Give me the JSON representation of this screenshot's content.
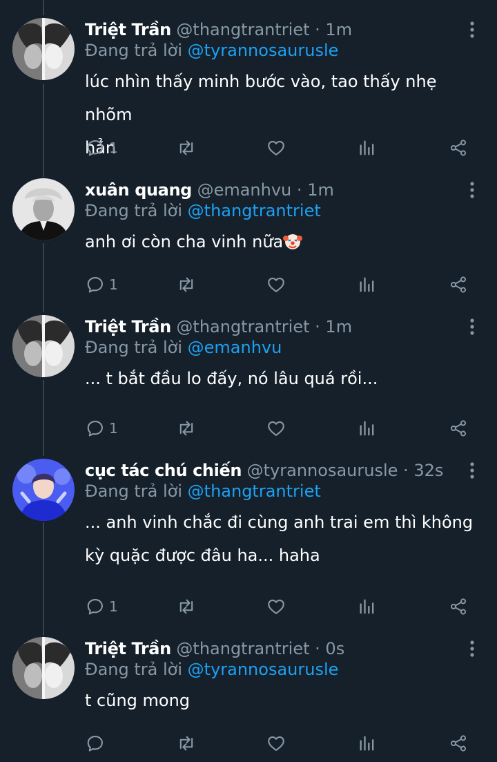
{
  "icons": {
    "more": "more-vertical-icon",
    "reply": "reply-bubble-icon",
    "retweet": "retweet-icon",
    "like": "heart-icon",
    "stats": "bar-chart-icon",
    "share": "share-icon",
    "emoji": "clown-face-emoji"
  },
  "colors": {
    "background": "#15202b",
    "link": "#1da1f2",
    "muted": "#8899a6",
    "thread_line": "#38444d"
  },
  "tweets": [
    {
      "name": "Triệt Trần",
      "handle": "@thangtrantriet",
      "time": "1m",
      "replying_prefix": "Đang trả lời",
      "reply_to": "@tyrannosaurusle",
      "text_lines": [
        "lúc nhìn thấy minh bước vào, tao thấy nhẹ nhõm",
        "hẳn"
      ],
      "reply_count": "1"
    },
    {
      "name": "xuân quang",
      "handle": "@emanhvu",
      "time": "1m",
      "replying_prefix": "Đang trả lời",
      "reply_to": "@thangtrantriet",
      "text_lines": [
        "anh ơi còn cha vinh nữa"
      ],
      "reply_count": "1"
    },
    {
      "name": "Triệt Trần",
      "handle": "@thangtrantriet",
      "time": "1m",
      "replying_prefix": "Đang trả lời",
      "reply_to": "@emanhvu",
      "text_lines": [
        "... t bắt đầu lo đấy, nó lâu quá rồi..."
      ],
      "reply_count": "1"
    },
    {
      "name": "cục tác chú chiến",
      "handle": "@tyrannosaurusle",
      "time": "32s",
      "replying_prefix": "Đang trả lời",
      "reply_to": "@thangtrantriet",
      "text_lines": [
        "... anh vinh chắc đi cùng anh trai em thì không",
        "kỳ quặc được đâu ha... haha"
      ],
      "reply_count": "1"
    },
    {
      "name": "Triệt Trần",
      "handle": "@thangtrantriet",
      "time": "0s",
      "replying_prefix": "Đang trả lời",
      "reply_to": "@tyrannosaurusle",
      "text_lines": [
        "t cũng mong"
      ],
      "reply_count": ""
    }
  ]
}
